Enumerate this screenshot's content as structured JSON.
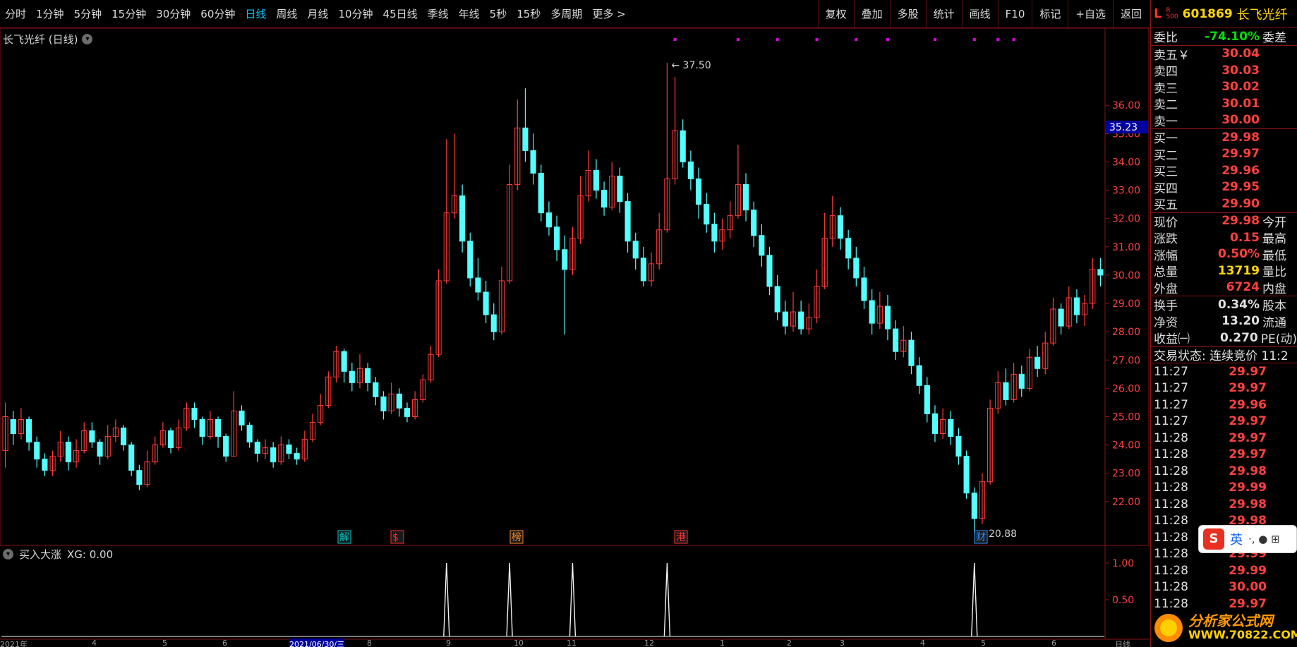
{
  "toolbar": {
    "timeframes": [
      "分时",
      "1分钟",
      "5分钟",
      "15分钟",
      "30分钟",
      "60分钟",
      "日线",
      "周线",
      "月线",
      "10分钟",
      "45日线",
      "季线",
      "年线",
      "5秒",
      "15秒",
      "多周期",
      "更多 >"
    ],
    "active": "日线",
    "tools": [
      "复权",
      "叠加",
      "多股",
      "统计",
      "画线",
      "F10",
      "标记",
      "+自选",
      "返回"
    ]
  },
  "chart": {
    "title": "长飞光纤 (日线)",
    "high_label": "37.50",
    "low_label": "20.88",
    "current_badge": "35.23",
    "y_ticks": [
      "36.00",
      "35.00",
      "34.00",
      "33.00",
      "32.00",
      "31.00",
      "30.00",
      "29.00",
      "28.00",
      "27.00",
      "26.00",
      "25.00",
      "24.00",
      "23.00",
      "22.00"
    ],
    "event_markers": [
      "解",
      "$",
      "榜",
      "港",
      "财"
    ],
    "date_labels": [
      "2021年",
      "4",
      "5",
      "6",
      "2021/06/30/三",
      "8",
      "9",
      "10",
      "11",
      "12",
      "1",
      "2",
      "3",
      "4",
      "5",
      "6"
    ],
    "bottom_right": "日线"
  },
  "indicator": {
    "name": "买入大涨",
    "value_label": "XG: 0.00",
    "y_ticks": [
      "1.00",
      "0.50"
    ]
  },
  "quote": {
    "market_letter": "L",
    "market_sub": [
      "R",
      "500"
    ],
    "code": "601869",
    "name": "长飞光纤",
    "weibi": {
      "k": "委比",
      "v": "-74.10%",
      "k2": "委差"
    },
    "asks": [
      {
        "k": "卖五￥",
        "v": "30.04"
      },
      {
        "k": "卖四",
        "v": "30.03"
      },
      {
        "k": "卖三",
        "v": "30.02"
      },
      {
        "k": "卖二",
        "v": "30.01"
      },
      {
        "k": "卖一",
        "v": "30.00"
      }
    ],
    "bids": [
      {
        "k": "买一",
        "v": "29.98"
      },
      {
        "k": "买二",
        "v": "29.97"
      },
      {
        "k": "买三",
        "v": "29.96"
      },
      {
        "k": "买四",
        "v": "29.95"
      },
      {
        "k": "买五",
        "v": "29.90"
      }
    ],
    "stats": [
      {
        "k": "现价",
        "v": "29.98",
        "k2": "今开",
        "c": "red"
      },
      {
        "k": "涨跌",
        "v": "0.15",
        "k2": "最高",
        "c": "red"
      },
      {
        "k": "涨幅",
        "v": "0.50%",
        "k2": "最低",
        "c": "red"
      },
      {
        "k": "总量",
        "v": "13719",
        "k2": "量比",
        "c": "yellow"
      },
      {
        "k": "外盘",
        "v": "6724",
        "k2": "内盘",
        "c": "red"
      }
    ],
    "stats2": [
      {
        "k": "换手",
        "v": "0.34%",
        "k2": "股本",
        "c": "white"
      },
      {
        "k": "净资",
        "v": "13.20",
        "k2": "流通",
        "c": "white"
      },
      {
        "k": "收益㈠",
        "v": "0.270",
        "k2": "PE(动)",
        "c": "white"
      }
    ],
    "trade_status": "交易状态: 连续竞价 11:2",
    "ticks": [
      {
        "t": "11:27",
        "p": "29.97"
      },
      {
        "t": "11:27",
        "p": "29.97"
      },
      {
        "t": "11:27",
        "p": "29.96"
      },
      {
        "t": "11:27",
        "p": "29.97"
      },
      {
        "t": "11:28",
        "p": "29.97"
      },
      {
        "t": "11:28",
        "p": "29.97"
      },
      {
        "t": "11:28",
        "p": "29.98"
      },
      {
        "t": "11:28",
        "p": "29.99"
      },
      {
        "t": "11:28",
        "p": "29.98"
      },
      {
        "t": "11:28",
        "p": "29.98"
      },
      {
        "t": "11:28",
        "p": "29.99"
      },
      {
        "t": "11:28",
        "p": "29.99"
      },
      {
        "t": "11:28",
        "p": "29.99"
      },
      {
        "t": "11:28",
        "p": "30.00"
      },
      {
        "t": "11:28",
        "p": "29.97"
      }
    ]
  },
  "ime": {
    "logo": "S",
    "lang": "英",
    "extra": "·, ● ⊞"
  },
  "watermark": {
    "line1": "分析家公式网",
    "line2": "WWW.70822.COM"
  },
  "colors": {
    "up": "#ff3c3c",
    "down": "#54ffff",
    "frame": "#8b1414",
    "signal": "#e000e0"
  },
  "chart_data": {
    "type": "candlestick",
    "ylim": [
      20.5,
      38.0
    ],
    "candles": [
      [
        23.8,
        25.0,
        25.5,
        23.2
      ],
      [
        24.9,
        24.4,
        25.2,
        24.0
      ],
      [
        24.4,
        24.9,
        25.3,
        24.2
      ],
      [
        24.9,
        24.1,
        25.0,
        23.8
      ],
      [
        24.1,
        23.5,
        24.3,
        23.2
      ],
      [
        23.5,
        23.1,
        23.7,
        22.9
      ],
      [
        23.1,
        23.6,
        23.8,
        22.9
      ],
      [
        23.6,
        24.1,
        24.5,
        23.4
      ],
      [
        24.1,
        23.4,
        24.3,
        23.1
      ],
      [
        23.4,
        23.8,
        24.2,
        23.2
      ],
      [
        23.8,
        24.5,
        24.8,
        23.7
      ],
      [
        24.5,
        24.1,
        24.8,
        23.9
      ],
      [
        24.1,
        23.6,
        24.2,
        23.3
      ],
      [
        23.6,
        24.3,
        24.7,
        23.5
      ],
      [
        24.3,
        24.6,
        24.9,
        24.1
      ],
      [
        24.6,
        24.0,
        24.7,
        23.8
      ],
      [
        24.0,
        23.1,
        24.1,
        22.9
      ],
      [
        23.1,
        22.6,
        23.3,
        22.4
      ],
      [
        22.6,
        23.4,
        23.8,
        22.5
      ],
      [
        23.4,
        24.0,
        24.3,
        23.3
      ],
      [
        24.0,
        24.5,
        24.8,
        23.9
      ],
      [
        24.5,
        23.9,
        24.6,
        23.7
      ],
      [
        23.9,
        24.6,
        24.9,
        23.8
      ],
      [
        24.6,
        25.3,
        25.5,
        24.5
      ],
      [
        25.3,
        24.9,
        25.5,
        24.6
      ],
      [
        24.9,
        24.3,
        25.0,
        24.0
      ],
      [
        24.3,
        24.9,
        25.2,
        24.2
      ],
      [
        24.9,
        24.3,
        25.0,
        23.9
      ],
      [
        24.3,
        23.6,
        24.4,
        23.4
      ],
      [
        23.6,
        25.2,
        25.9,
        23.6
      ],
      [
        25.2,
        24.7,
        25.4,
        24.5
      ],
      [
        24.7,
        24.1,
        24.8,
        23.9
      ],
      [
        24.1,
        23.7,
        24.2,
        23.4
      ],
      [
        23.7,
        23.9,
        24.2,
        23.5
      ],
      [
        23.9,
        23.4,
        24.1,
        23.2
      ],
      [
        23.4,
        24.0,
        24.3,
        23.3
      ],
      [
        24.0,
        23.7,
        24.2,
        23.5
      ],
      [
        23.7,
        23.5,
        23.9,
        23.3
      ],
      [
        23.5,
        24.2,
        24.5,
        23.4
      ],
      [
        24.2,
        24.8,
        25.1,
        24.1
      ],
      [
        24.8,
        25.4,
        25.8,
        24.7
      ],
      [
        25.4,
        26.4,
        26.6,
        25.3
      ],
      [
        26.4,
        27.3,
        27.5,
        26.2
      ],
      [
        27.3,
        26.6,
        27.4,
        26.2
      ],
      [
        26.6,
        26.2,
        26.9,
        25.9
      ],
      [
        26.2,
        26.7,
        27.2,
        26.0
      ],
      [
        26.7,
        26.2,
        26.9,
        25.9
      ],
      [
        26.2,
        25.7,
        26.4,
        25.4
      ],
      [
        25.7,
        25.2,
        25.9,
        24.9
      ],
      [
        25.2,
        25.8,
        26.2,
        25.1
      ],
      [
        25.8,
        25.3,
        26.0,
        25.0
      ],
      [
        25.3,
        25.0,
        25.5,
        24.8
      ],
      [
        25.0,
        25.6,
        25.9,
        24.9
      ],
      [
        25.6,
        26.3,
        26.5,
        25.5
      ],
      [
        26.3,
        27.2,
        27.5,
        26.2
      ],
      [
        27.2,
        29.8,
        30.2,
        27.1
      ],
      [
        29.8,
        32.2,
        34.8,
        29.7
      ],
      [
        32.2,
        32.8,
        35.0,
        32.0
      ],
      [
        32.8,
        31.2,
        33.2,
        30.8
      ],
      [
        31.2,
        29.9,
        31.5,
        29.6
      ],
      [
        29.9,
        29.4,
        30.6,
        29.1
      ],
      [
        29.4,
        28.6,
        29.8,
        28.3
      ],
      [
        28.6,
        28.0,
        29.0,
        27.7
      ],
      [
        28.0,
        29.8,
        30.3,
        27.9
      ],
      [
        29.8,
        33.2,
        33.9,
        29.7
      ],
      [
        33.2,
        35.2,
        36.2,
        33.0
      ],
      [
        35.2,
        34.4,
        36.6,
        34.0
      ],
      [
        34.4,
        33.6,
        35.0,
        33.2
      ],
      [
        33.6,
        32.2,
        33.9,
        31.9
      ],
      [
        32.2,
        31.7,
        32.6,
        31.4
      ],
      [
        31.7,
        30.9,
        32.1,
        30.5
      ],
      [
        30.9,
        30.2,
        31.4,
        27.9
      ],
      [
        30.2,
        31.3,
        31.7,
        30.0
      ],
      [
        31.3,
        32.8,
        33.5,
        31.1
      ],
      [
        32.8,
        33.7,
        34.4,
        32.6
      ],
      [
        33.7,
        33.0,
        34.1,
        32.7
      ],
      [
        33.0,
        32.4,
        33.3,
        32.1
      ],
      [
        32.4,
        33.5,
        34.0,
        32.3
      ],
      [
        33.5,
        32.6,
        33.8,
        32.2
      ],
      [
        32.6,
        31.2,
        32.9,
        30.8
      ],
      [
        31.2,
        30.6,
        31.5,
        30.2
      ],
      [
        30.6,
        29.8,
        31.0,
        29.6
      ],
      [
        29.8,
        30.4,
        30.8,
        29.6
      ],
      [
        30.4,
        31.6,
        32.2,
        30.2
      ],
      [
        31.6,
        33.4,
        37.5,
        31.5
      ],
      [
        33.4,
        35.1,
        37.0,
        33.2
      ],
      [
        35.1,
        34.0,
        35.5,
        33.8
      ],
      [
        34.0,
        33.4,
        34.4,
        33.0
      ],
      [
        33.4,
        32.5,
        33.8,
        32.0
      ],
      [
        32.5,
        31.8,
        32.9,
        31.5
      ],
      [
        31.8,
        31.2,
        32.2,
        30.8
      ],
      [
        31.2,
        31.6,
        32.0,
        30.9
      ],
      [
        31.6,
        32.1,
        32.6,
        31.3
      ],
      [
        32.1,
        33.2,
        34.6,
        32.0
      ],
      [
        33.2,
        32.3,
        33.6,
        31.9
      ],
      [
        32.3,
        31.4,
        32.6,
        31.0
      ],
      [
        31.4,
        30.7,
        31.8,
        30.3
      ],
      [
        30.7,
        29.6,
        31.0,
        29.3
      ],
      [
        29.6,
        28.7,
        30.0,
        28.4
      ],
      [
        28.7,
        28.2,
        29.1,
        27.9
      ],
      [
        28.2,
        28.7,
        29.4,
        28.0
      ],
      [
        28.7,
        28.1,
        29.1,
        27.9
      ],
      [
        28.1,
        28.5,
        29.0,
        27.9
      ],
      [
        28.5,
        29.6,
        30.2,
        28.3
      ],
      [
        29.6,
        31.3,
        32.2,
        29.5
      ],
      [
        31.3,
        32.1,
        32.8,
        31.0
      ],
      [
        32.1,
        31.3,
        32.4,
        30.9
      ],
      [
        31.3,
        30.6,
        31.6,
        30.2
      ],
      [
        30.6,
        29.9,
        31.0,
        29.6
      ],
      [
        29.9,
        29.1,
        30.3,
        28.8
      ],
      [
        29.1,
        28.3,
        29.5,
        27.9
      ],
      [
        28.3,
        28.9,
        29.4,
        28.1
      ],
      [
        28.9,
        28.1,
        29.3,
        27.7
      ],
      [
        28.1,
        27.3,
        28.4,
        27.0
      ],
      [
        27.3,
        27.7,
        28.2,
        27.1
      ],
      [
        27.7,
        26.8,
        28.0,
        26.5
      ],
      [
        26.8,
        26.1,
        27.1,
        25.8
      ],
      [
        26.1,
        25.1,
        26.4,
        24.8
      ],
      [
        25.1,
        24.4,
        25.4,
        24.1
      ],
      [
        24.4,
        24.9,
        25.3,
        24.2
      ],
      [
        24.9,
        24.3,
        25.2,
        24.0
      ],
      [
        24.3,
        23.6,
        24.6,
        23.3
      ],
      [
        23.6,
        22.3,
        23.8,
        22.1
      ],
      [
        22.3,
        21.4,
        22.5,
        20.88
      ],
      [
        21.4,
        22.7,
        23.0,
        21.2
      ],
      [
        22.7,
        25.3,
        25.6,
        22.6
      ],
      [
        25.3,
        26.2,
        26.6,
        25.1
      ],
      [
        26.2,
        25.6,
        26.7,
        25.4
      ],
      [
        25.6,
        26.5,
        26.9,
        25.5
      ],
      [
        26.5,
        26.0,
        26.8,
        25.7
      ],
      [
        26.0,
        27.1,
        27.4,
        25.9
      ],
      [
        27.1,
        26.7,
        27.5,
        26.4
      ],
      [
        26.7,
        27.6,
        28.0,
        26.5
      ],
      [
        27.6,
        28.8,
        29.2,
        27.5
      ],
      [
        28.8,
        28.2,
        29.0,
        27.9
      ],
      [
        28.2,
        29.2,
        29.6,
        28.1
      ],
      [
        29.2,
        28.6,
        29.5,
        28.3
      ],
      [
        28.6,
        29.0,
        29.3,
        28.2
      ],
      [
        29.0,
        30.2,
        30.6,
        28.8
      ],
      [
        30.2,
        30.0,
        30.6,
        29.6
      ]
    ],
    "signal_days": [
      56,
      64,
      72,
      84,
      123
    ]
  }
}
